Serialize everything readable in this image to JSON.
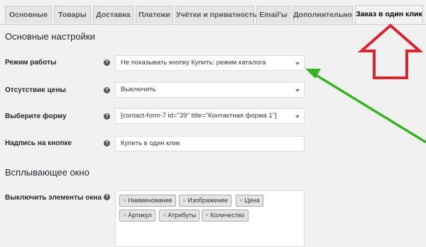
{
  "tabs": [
    {
      "label": "Основные"
    },
    {
      "label": "Товары"
    },
    {
      "label": "Доставка"
    },
    {
      "label": "Платежи"
    },
    {
      "label": "Учётки и приватность"
    },
    {
      "label": "Email'ы"
    },
    {
      "label": "Дополнительно"
    },
    {
      "label": "Заказ в один клик",
      "active": true
    }
  ],
  "sections": {
    "main_title": "Основные настройки",
    "popup_title": "Всплывающее окно"
  },
  "fields": {
    "mode": {
      "label": "Режим работы",
      "value": "Не показывать кнопку Купить: режим каталога"
    },
    "no_price": {
      "label": "Отсутствие цены",
      "value": "Выключить"
    },
    "form": {
      "label": "Выберите форму",
      "value": "[contact-form-7 id=\"39\" title=\"Контактная форма 1\"]"
    },
    "button_text": {
      "label": "Надпись на кнопке",
      "value": "Купить в один клик"
    },
    "disable_elements": {
      "label": "Выключить элементы окна",
      "chips": [
        "Наименование",
        "Изображение",
        "Цена",
        "Артикул",
        "Атрибуты",
        "Количество"
      ]
    }
  },
  "help_glyph": "?",
  "chip_remove_glyph": "×",
  "colors": {
    "arrow_red": "#d9232e",
    "arrow_green": "#35b51f"
  }
}
